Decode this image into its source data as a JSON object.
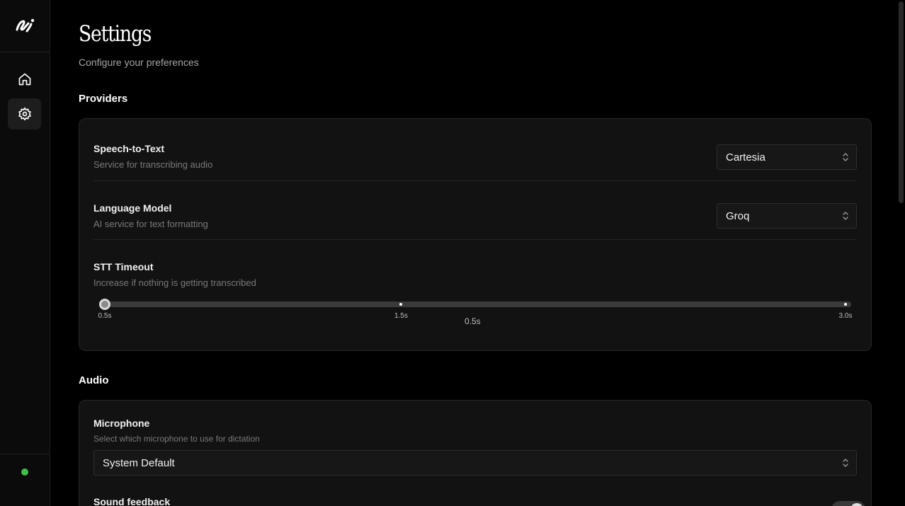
{
  "sidebar": {
    "logo_icon": "brand-logo-icon",
    "nav": [
      {
        "name": "home",
        "icon": "home-icon",
        "active": false
      },
      {
        "name": "settings",
        "icon": "gear-icon",
        "active": true
      }
    ],
    "status_color": "#3fbf4a"
  },
  "page": {
    "title": "Settings",
    "subtitle": "Configure your preferences"
  },
  "providers": {
    "section_title": "Providers",
    "speech_to_text": {
      "label": "Speech-to-Text",
      "description": "Service for transcribing audio",
      "value": "Cartesia"
    },
    "language_model": {
      "label": "Language Model",
      "description": "AI service for text formatting",
      "value": "Groq"
    },
    "stt_timeout": {
      "label": "STT Timeout",
      "description": "Increase if nothing is getting transcribed",
      "min_label": "0.5s",
      "mid_label": "1.5s",
      "max_label": "3.0s",
      "current_label": "0.5s",
      "min": 0.5,
      "max": 3.0,
      "marks": [
        0.5,
        1.5,
        3.0
      ],
      "value": 0.5
    }
  },
  "audio": {
    "section_title": "Audio",
    "microphone": {
      "label": "Microphone",
      "description": "Select which microphone to use for dictation",
      "value": "System Default"
    },
    "sound_feedback": {
      "label": "Sound feedback",
      "enabled": true
    }
  },
  "colors": {
    "background": "#000000",
    "sidebar": "#0b0b0b",
    "card": "#121212",
    "status_online": "#3fbf4a"
  }
}
